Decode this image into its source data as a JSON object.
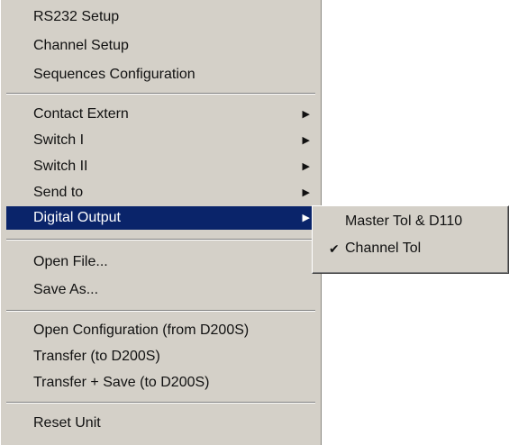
{
  "main_menu": {
    "group1": [
      "RS232 Setup",
      "Channel Setup",
      "Sequences Configuration"
    ],
    "group2": [
      "Contact Extern",
      "Switch I",
      "Switch II",
      "Send to",
      "Digital Output"
    ],
    "group3": [
      "Open File...",
      "Save As..."
    ],
    "group4": [
      "Open Configuration (from D200S)",
      "Transfer (to D200S)",
      "Transfer + Save (to D200S)"
    ],
    "group5": [
      "Reset Unit"
    ],
    "submenu_arrow": "▶"
  },
  "submenu": {
    "items": [
      "Master Tol & D110",
      "Channel Tol"
    ],
    "checkmark": "✔",
    "checked_item": "Channel Tol"
  },
  "colors": {
    "menu_background": "#d4d0c8",
    "highlight": "#0a246a",
    "highlight_text": "#ffffff"
  }
}
